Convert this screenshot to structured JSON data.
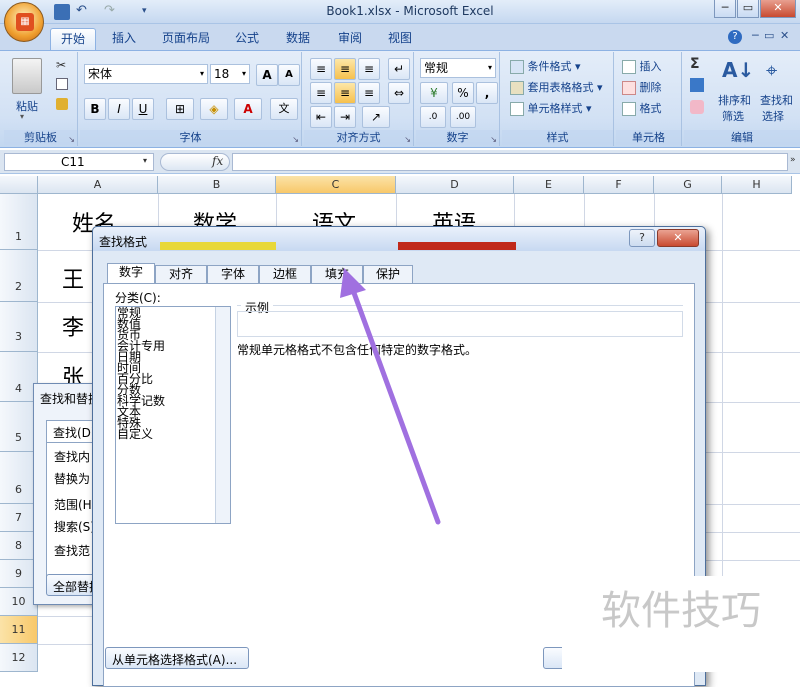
{
  "window": {
    "title": "Book1.xlsx - Microsoft Excel"
  },
  "ribbon": {
    "tabs": [
      "开始",
      "插入",
      "页面布局",
      "公式",
      "数据",
      "审阅",
      "视图"
    ],
    "active_tab": "开始",
    "clipboard": {
      "paste": "粘贴",
      "label": "剪贴板"
    },
    "font": {
      "name": "宋体",
      "size": "18",
      "label": "字体",
      "bold": "B",
      "italic": "I",
      "underline": "U",
      "grow": "A",
      "shrink": "A",
      "font_color": "A",
      "wen": "文"
    },
    "alignment": {
      "label": "对齐方式"
    },
    "number": {
      "format": "常规",
      "label": "数字",
      "percent": "%",
      "comma": ","
    },
    "styles": {
      "conditional": "条件格式",
      "table": "套用表格格式",
      "cell_styles": "单元格样式",
      "label": "样式"
    },
    "cells": {
      "insert": "插入",
      "delete": "删除",
      "format": "格式",
      "label": "单元格"
    },
    "editing": {
      "sigma": "Σ",
      "sort": "排序和",
      "sort2": "筛选",
      "find": "查找和",
      "find2": "选择",
      "label": "编辑"
    }
  },
  "formula_bar": {
    "cell_ref": "C11",
    "fx": "fx",
    "value": ""
  },
  "columns": [
    "A",
    "B",
    "C",
    "D",
    "E",
    "F",
    "G",
    "H"
  ],
  "rows": [
    "1",
    "2",
    "3",
    "4",
    "5",
    "6",
    "7",
    "8",
    "9",
    "10",
    "11",
    "12"
  ],
  "cells": {
    "a1": "姓名",
    "b1": "数学",
    "c1": "语文",
    "d1": "英语",
    "a2": "王",
    "a3": "李",
    "a4": "张"
  },
  "find_replace_dialog": {
    "title": "查找和替换",
    "tab_find": "查找(D)",
    "find_what": "查找内",
    "replace_with": "替换为",
    "within": "范围(H)",
    "search": "搜索(S)",
    "look_in": "查找范",
    "replace_all": "全部替换"
  },
  "format_dialog": {
    "title": "查找格式",
    "help": "?",
    "close": "✕",
    "tabs": [
      "数字",
      "对齐",
      "字体",
      "边框",
      "填充",
      "保护"
    ],
    "active_tab": "数字",
    "category_label": "分类(C):",
    "categories": [
      "常规",
      "数值",
      "货币",
      "会计专用",
      "日期",
      "时间",
      "百分比",
      "分数",
      "科学记数",
      "文本",
      "特殊",
      "自定义"
    ],
    "sample_label": "示例",
    "description": "常规单元格格式不包含任何特定的数字格式。",
    "choose_from_cell": "从单元格选择格式(A)..."
  },
  "watermark": "软件技巧",
  "colors": {
    "annotation_arrow": "#a070e0",
    "highlight_yellow": "#e8d838",
    "highlight_red": "#c0281a"
  }
}
